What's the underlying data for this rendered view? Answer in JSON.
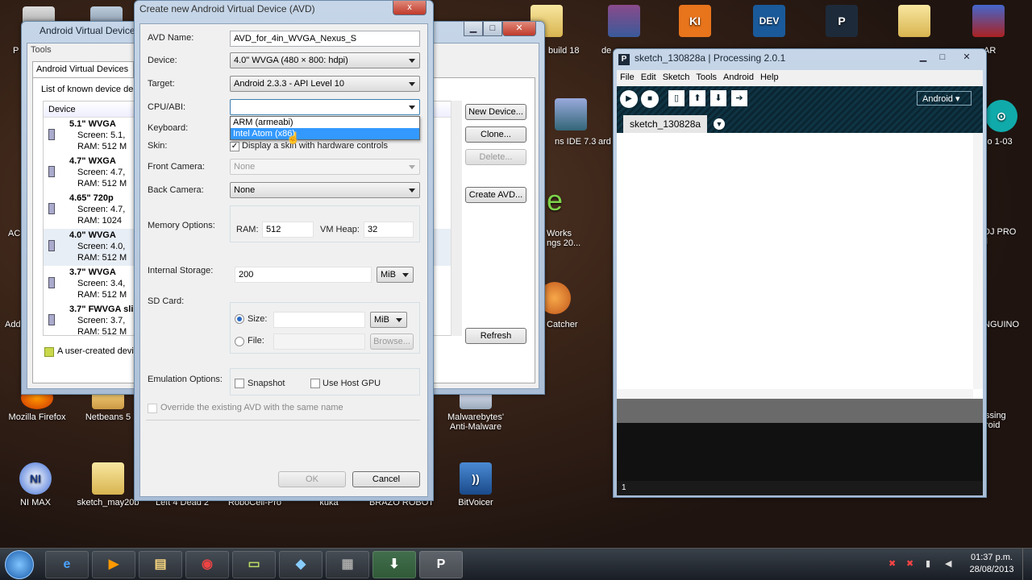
{
  "desktop": {
    "icons": [
      {
        "label": "Mozilla Firefox",
        "glyph": "🦊"
      },
      {
        "label": "Netbeans 5",
        "glyph": "NB"
      },
      {
        "label": "Malwarebytes'\nAnti-Malware",
        "glyph": "M"
      },
      {
        "label": "NI MAX",
        "glyph": "NI"
      },
      {
        "label": "sketch_may20b",
        "glyph": "📁"
      },
      {
        "label": "Left 4 Dead 2",
        "glyph": ""
      },
      {
        "label": "RoboCell-Pro",
        "glyph": ""
      },
      {
        "label": "kuka",
        "glyph": ""
      },
      {
        "label": "BRAZO ROBOT",
        "glyph": ""
      },
      {
        "label": "BitVoicer",
        "glyph": "))"
      }
    ],
    "partial_labels": [
      "build 18",
      "de",
      "ns IDE 7.3",
      "ard",
      "e",
      "Works\nngs 20...",
      "Catcher",
      "AR",
      "io 1-03",
      "DJ PRO\nll",
      "NGUINO",
      "ssing\nroid",
      "P",
      "AC",
      "Add"
    ],
    "top_tiles": [
      "KI",
      "DEV",
      "P"
    ]
  },
  "avd_manager": {
    "title": "Android Virtual Device",
    "menu": "Tools",
    "tab": "Android Virtual Devices",
    "list_caption": "List of known device de",
    "column": "Device",
    "devices": [
      {
        "name": "5.1\" WVGA",
        "screen": "Screen: 5.1,",
        "ram": "RAM: 512 M"
      },
      {
        "name": "4.7\" WXGA",
        "screen": "Screen: 4.7,",
        "ram": "RAM: 512 M"
      },
      {
        "name": "4.65\" 720p",
        "screen": "Screen: 4.7,",
        "ram": "RAM: 1024"
      },
      {
        "name": "4.0\" WVGA",
        "screen": "Screen: 4.0,",
        "ram": "RAM: 512 M"
      },
      {
        "name": "3.7\" WVGA",
        "screen": "Screen: 3.4,",
        "ram": "RAM: 512 M"
      },
      {
        "name": "3.7\" FWVGA sli",
        "screen": "Screen: 3.7,",
        "ram": "RAM: 512 M"
      }
    ],
    "footer_note": "A user-created devi",
    "buttons": {
      "new": "New Device...",
      "clone": "Clone...",
      "delete": "Delete...",
      "create": "Create AVD...",
      "refresh": "Refresh"
    }
  },
  "avd_dialog": {
    "title": "Create new Android Virtual Device (AVD)",
    "close_glyph": "x",
    "labels": {
      "name": "AVD Name:",
      "device": "Device:",
      "target": "Target:",
      "cpu": "CPU/ABI:",
      "keyboard": "Keyboard:",
      "skin": "Skin:",
      "front": "Front Camera:",
      "back": "Back Camera:",
      "memory": "Memory Options:",
      "ram": "RAM:",
      "vmheap": "VM Heap:",
      "storage": "Internal Storage:",
      "sdcard": "SD Card:",
      "size": "Size:",
      "file": "File:",
      "emulation": "Emulation Options:",
      "snapshot": "Snapshot",
      "hostgpu": "Use Host GPU",
      "override": "Override the existing AVD with the same name"
    },
    "values": {
      "name": "AVD_for_4in_WVGA_Nexus_S",
      "device": "4.0\" WVGA (480 × 800: hdpi)",
      "target": "Android 2.3.3 - API Level 10",
      "cpu": "",
      "skin": "Display a skin with hardware controls",
      "front": "None",
      "back": "None",
      "ram": "512",
      "vmheap": "32",
      "storage": "200",
      "storage_unit": "MiB",
      "sd_unit": "MiB",
      "browse": "Browse..."
    },
    "cpu_options": [
      "ARM (armeabi)",
      "Intel Atom (x86)"
    ],
    "cpu_selected_index": 1,
    "buttons": {
      "ok": "OK",
      "cancel": "Cancel"
    }
  },
  "processing": {
    "title": "sketch_130828a | Processing 2.0.1",
    "menu": [
      "File",
      "Edit",
      "Sketch",
      "Tools",
      "Android",
      "Help"
    ],
    "mode": "Android",
    "tab": "sketch_130828a",
    "line_number": "1"
  },
  "taskbar": {
    "clock_time": "01:37 p.m.",
    "clock_date": "28/08/2013",
    "pinned": [
      "ie",
      "media",
      "explorer",
      "chrome",
      "notes",
      "app",
      "sketch",
      "download",
      "processing"
    ]
  },
  "colors": {
    "selection": "#3399ff",
    "dialog_bg": "#f0f0f0",
    "processing_dark": "#1a1a1a",
    "processing_toolbar": "#0e2a36"
  }
}
